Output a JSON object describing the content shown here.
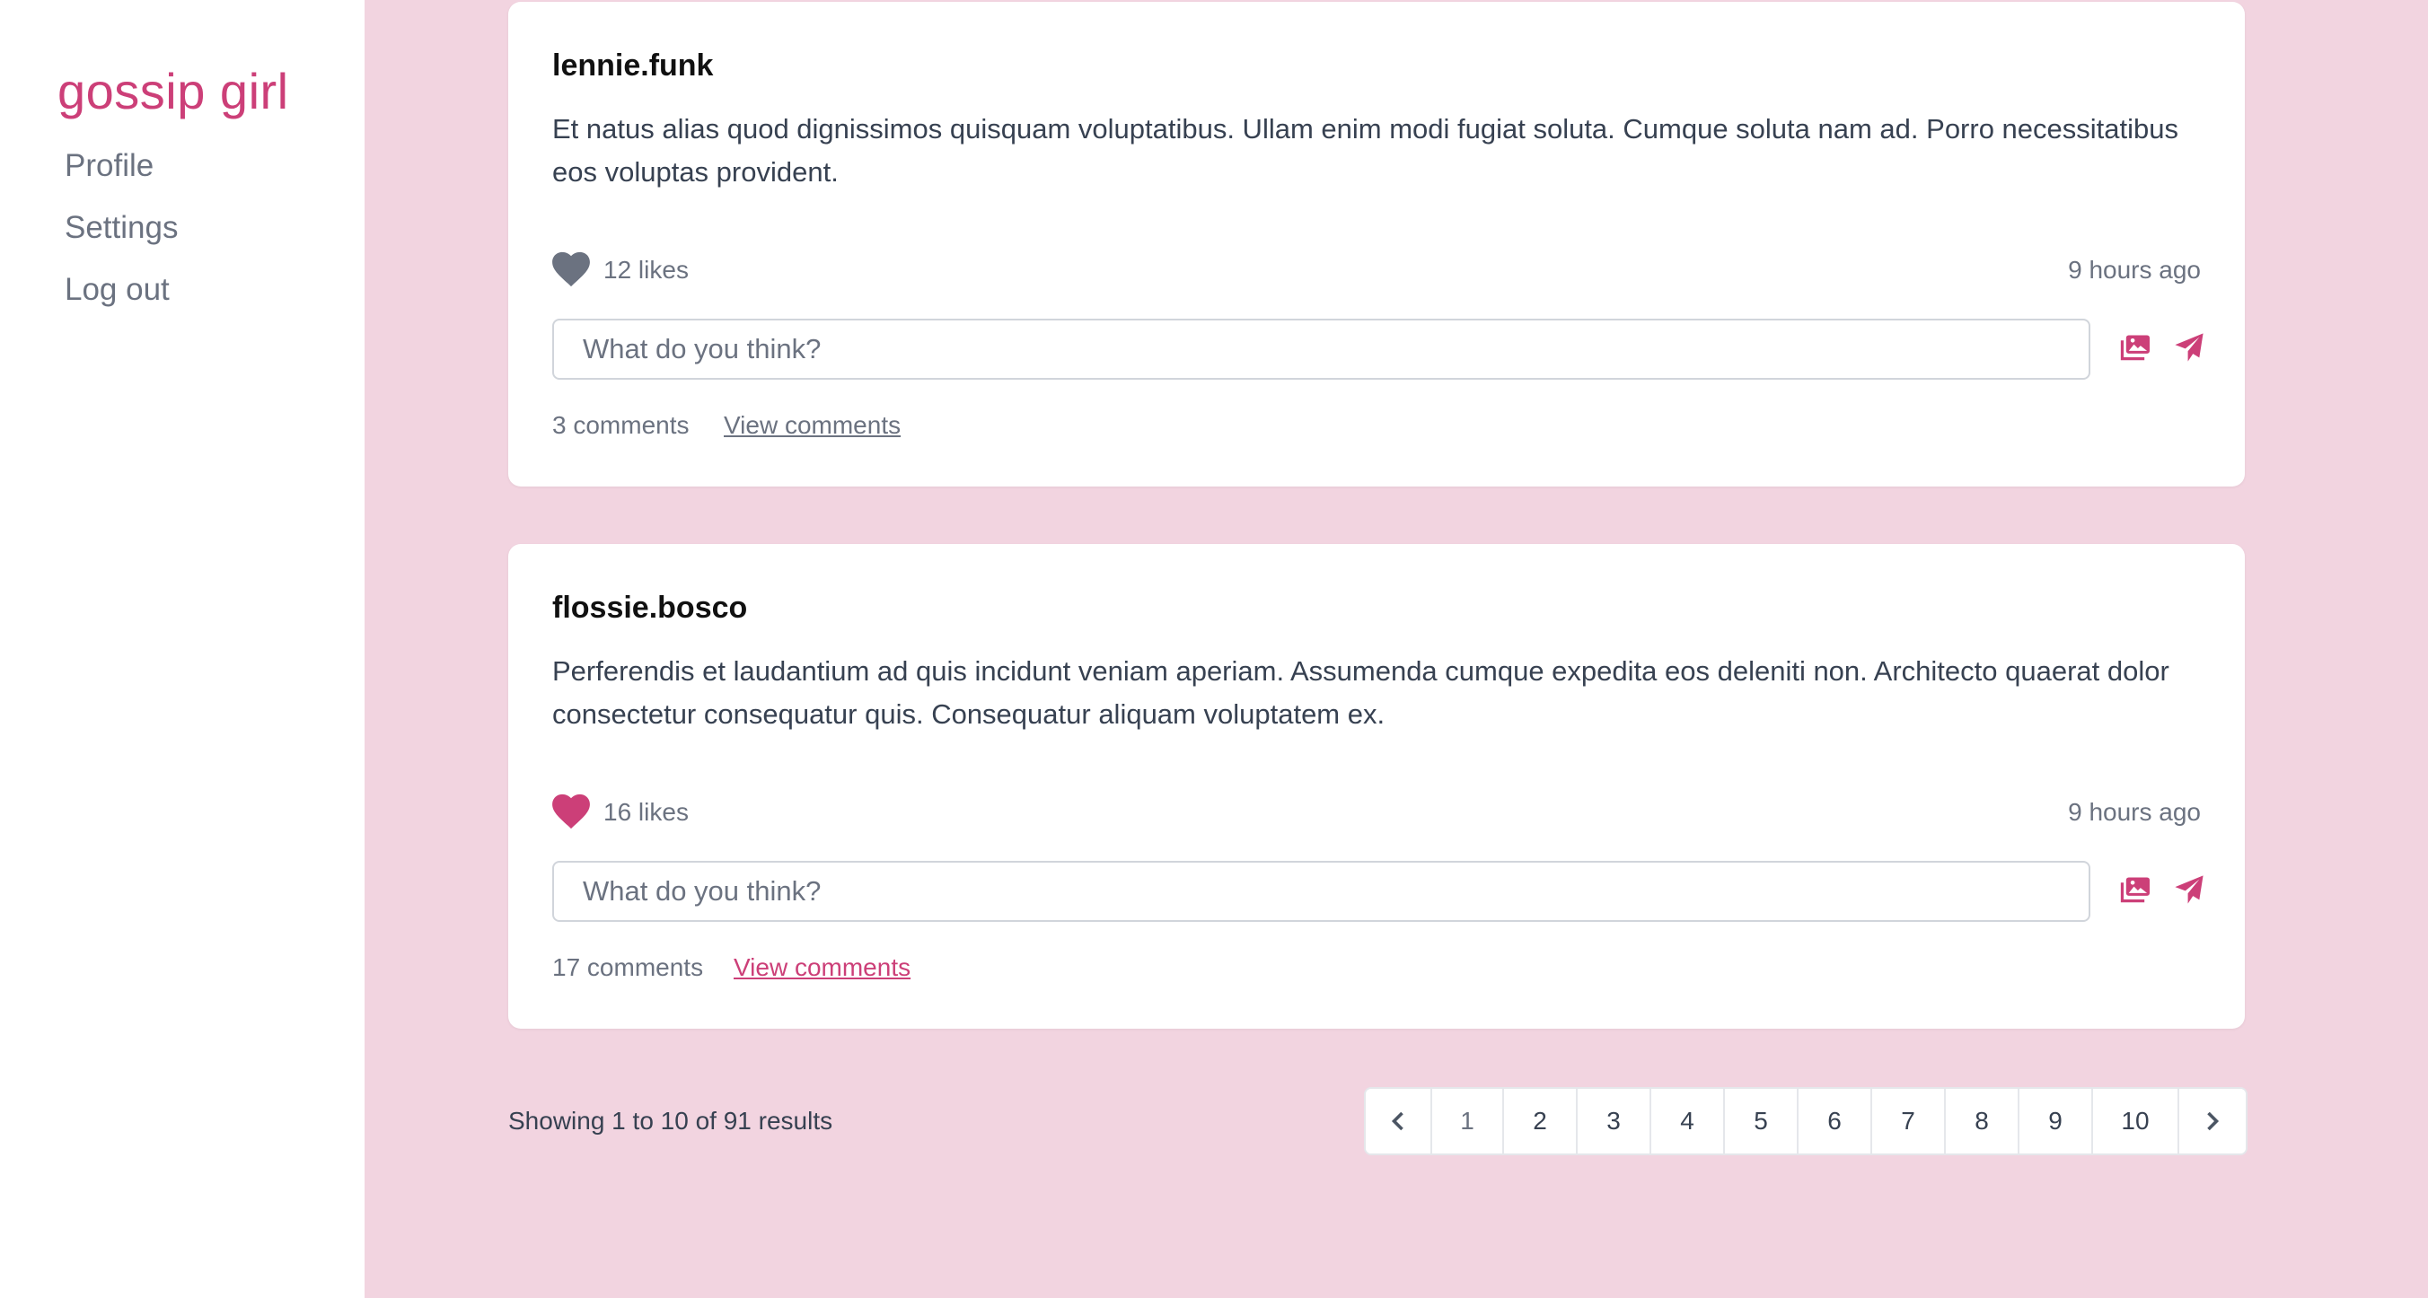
{
  "app": {
    "name": "gossip girl",
    "accent": "#cc3f78"
  },
  "sidebar": {
    "items": [
      {
        "label": "Profile"
      },
      {
        "label": "Settings"
      },
      {
        "label": "Log out"
      }
    ]
  },
  "posts": [
    {
      "username": "lennie.funk",
      "body": "Et natus alias quod dignissimos quisquam voluptatibus. Ullam enim modi fugiat soluta. Cumque soluta nam ad. Porro necessitatibus eos voluptas provident.",
      "likes": "12 likes",
      "liked": false,
      "heart_color": "#6b7280",
      "time": "9 hours ago",
      "comment_placeholder": "What do you think?",
      "comments_count": "3 comments",
      "view_comments_label": "View comments",
      "image_icon": "image-icon",
      "send_icon": "send-icon"
    },
    {
      "username": "flossie.bosco",
      "body": "Perferendis et laudantium ad quis incidunt veniam aperiam. Assumenda cumque expedita eos deleniti non. Architecto quaerat dolor consectetur consequatur quis. Consequatur aliquam voluptatem ex.",
      "likes": "16 likes",
      "liked": true,
      "heart_color": "#cc3f78",
      "time": "9 hours ago",
      "comment_placeholder": "What do you think?",
      "comments_count": "17 comments",
      "view_comments_label": "View comments",
      "image_icon": "image-icon",
      "send_icon": "send-icon"
    }
  ],
  "pagination": {
    "summary": "Showing 1 to 10 of 91 results",
    "prev_icon": "chevron-left-icon",
    "next_icon": "chevron-right-icon",
    "current_page": "1",
    "pages": [
      "1",
      "2",
      "3",
      "4",
      "5",
      "6",
      "7",
      "8",
      "9",
      "10"
    ]
  }
}
